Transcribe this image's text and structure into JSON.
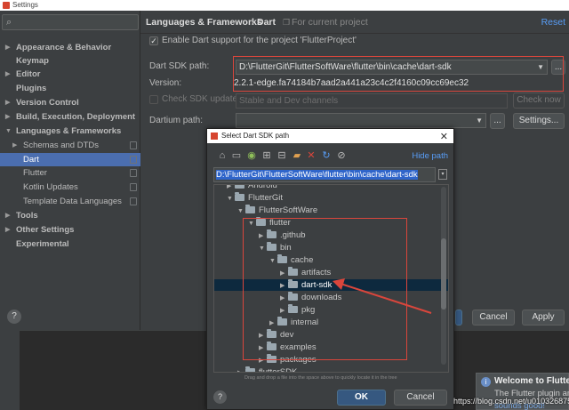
{
  "window": {
    "title": "Settings"
  },
  "sidebar": {
    "items": [
      {
        "label": "Appearance & Behavior",
        "arrow": "▶",
        "bold": true
      },
      {
        "label": "Keymap",
        "arrow": "",
        "bold": true
      },
      {
        "label": "Editor",
        "arrow": "▶",
        "bold": true
      },
      {
        "label": "Plugins",
        "arrow": "",
        "bold": true
      },
      {
        "label": "Version Control",
        "arrow": "▶",
        "bold": true
      },
      {
        "label": "Build, Execution, Deployment",
        "arrow": "▶",
        "bold": true
      },
      {
        "label": "Languages & Frameworks",
        "arrow": "▼",
        "bold": true
      },
      {
        "label": "Schemas and DTDs",
        "arrow": "▶",
        "bold": false
      },
      {
        "label": "Dart",
        "arrow": "",
        "bold": false,
        "selected": true
      },
      {
        "label": "Flutter",
        "arrow": "",
        "bold": false
      },
      {
        "label": "Kotlin Updates",
        "arrow": "",
        "bold": false
      },
      {
        "label": "Template Data Languages",
        "arrow": "",
        "bold": false
      },
      {
        "label": "Tools",
        "arrow": "▶",
        "bold": true
      },
      {
        "label": "Other Settings",
        "arrow": "▶",
        "bold": true
      },
      {
        "label": "Experimental",
        "arrow": "",
        "bold": true
      }
    ]
  },
  "breadcrumb": {
    "section": "Languages & Frameworks",
    "separator": "›",
    "page": "Dart",
    "scope": "For current project",
    "reset": "Reset"
  },
  "dart_settings": {
    "enable_label": "Enable Dart support for the project 'FlutterProject'",
    "sdk_path_label": "Dart SDK path:",
    "sdk_path_value": "D:\\FlutterGit\\FlutterSoftWare\\flutter\\bin\\cache\\dart-sdk",
    "version_label": "Version:",
    "version_value": "2.2.1-edge.fa74184b7aad2a441a23c4c2f4160c09cc69ec32",
    "check_sdk_label": "Check SDK update:",
    "check_sdk_channel": "Stable and Dev channels",
    "check_now": "Check now",
    "dartium_label": "Dartium path:",
    "settings_btn": "Settings...",
    "browse_btn": "..."
  },
  "footer": {
    "cancel": "Cancel",
    "apply": "Apply",
    "help": "?"
  },
  "dialog": {
    "title": "Select Dart SDK path",
    "hide_path": "Hide path",
    "path_value": "D:\\FlutterGit\\FlutterSoftWare\\flutter\\bin\\cache\\dart-sdk",
    "tree": [
      {
        "label": "Android",
        "depth": 0,
        "arrow": "▶"
      },
      {
        "label": "FlutterGit",
        "depth": 0,
        "arrow": "▼"
      },
      {
        "label": "FlutterSoftWare",
        "depth": 1,
        "arrow": "▼"
      },
      {
        "label": "flutter",
        "depth": 2,
        "arrow": "▼"
      },
      {
        "label": ".github",
        "depth": 3,
        "arrow": "▶"
      },
      {
        "label": "bin",
        "depth": 3,
        "arrow": "▼"
      },
      {
        "label": "cache",
        "depth": 4,
        "arrow": "▼"
      },
      {
        "label": "artifacts",
        "depth": 5,
        "arrow": "▶"
      },
      {
        "label": "dart-sdk",
        "depth": 5,
        "arrow": "▶",
        "selected": true
      },
      {
        "label": "downloads",
        "depth": 5,
        "arrow": "▶"
      },
      {
        "label": "pkg",
        "depth": 5,
        "arrow": "▶"
      },
      {
        "label": "internal",
        "depth": 4,
        "arrow": "▶"
      },
      {
        "label": "dev",
        "depth": 3,
        "arrow": "▶"
      },
      {
        "label": "examples",
        "depth": 3,
        "arrow": "▶"
      },
      {
        "label": "packages",
        "depth": 3,
        "arrow": "▶"
      },
      {
        "label": "flutterSDK",
        "depth": 1,
        "arrow": "▶"
      }
    ],
    "drag_hint": "Drag and drop a file into the space above to quickly locate it in the tree",
    "ok": "OK",
    "cancel": "Cancel",
    "help": "?"
  },
  "notification": {
    "title": "Welcome to Flutter",
    "body": "The Flutter plugin an",
    "tail": "sounds good!"
  },
  "watermark": "https://blog.csdn.net/u010326875",
  "colors": {
    "accent": "#589df6",
    "selection": "#4b6eaf",
    "highlight_box": "#d9463c"
  }
}
